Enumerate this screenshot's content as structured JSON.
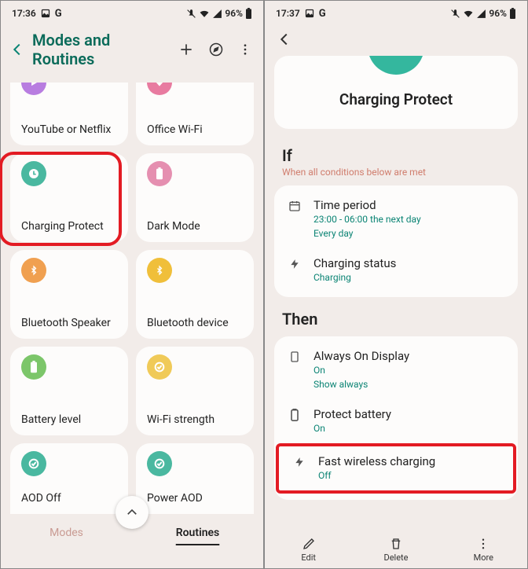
{
  "left": {
    "status": {
      "time": "17:36",
      "battery": "96%"
    },
    "header": {
      "title": "Modes and Routines"
    },
    "tiles": [
      {
        "label": "YouTube or Netflix",
        "color": "c-purple",
        "icon": "play"
      },
      {
        "label": "Office Wi-Fi",
        "color": "c-pink",
        "icon": "wifi"
      },
      {
        "label": "Charging Protect",
        "color": "c-teal",
        "icon": "clock",
        "highlighted": true
      },
      {
        "label": "Dark Mode",
        "color": "c-pink2",
        "icon": "battery"
      },
      {
        "label": "Bluetooth Speaker",
        "color": "c-orange",
        "icon": "bluetooth"
      },
      {
        "label": "Bluetooth device",
        "color": "c-yellow",
        "icon": "bluetooth"
      },
      {
        "label": "Battery level",
        "color": "c-green",
        "icon": "battery"
      },
      {
        "label": "Wi-Fi strength",
        "color": "c-ylight",
        "icon": "check"
      },
      {
        "label": "AOD Off",
        "color": "c-tealcheck",
        "icon": "check"
      },
      {
        "label": "Power AOD",
        "color": "c-tealcheck",
        "icon": "check"
      }
    ],
    "tabs": {
      "modes": "Modes",
      "routines": "Routines"
    }
  },
  "right": {
    "status": {
      "time": "17:37",
      "battery": "96%"
    },
    "hero": {
      "title": "Charging Protect"
    },
    "if": {
      "heading": "If",
      "sub": "When all conditions below are met",
      "rows": [
        {
          "icon": "calendar",
          "title": "Time period",
          "line1": "23:00 - 06:00 the next day",
          "line2": "Every day"
        },
        {
          "icon": "bolt",
          "title": "Charging status",
          "line1": "Charging",
          "line2": ""
        }
      ]
    },
    "then": {
      "heading": "Then",
      "rows": [
        {
          "icon": "monitor",
          "title": "Always On Display",
          "line1": "On",
          "line2": "Show always"
        },
        {
          "icon": "battery",
          "title": "Protect battery",
          "line1": "On",
          "line2": ""
        },
        {
          "icon": "bolt",
          "title": "Fast wireless charging",
          "line1": "Off",
          "line2": "",
          "highlighted": true
        }
      ]
    },
    "actions": {
      "edit": "Edit",
      "delete": "Delete",
      "more": "More"
    }
  }
}
